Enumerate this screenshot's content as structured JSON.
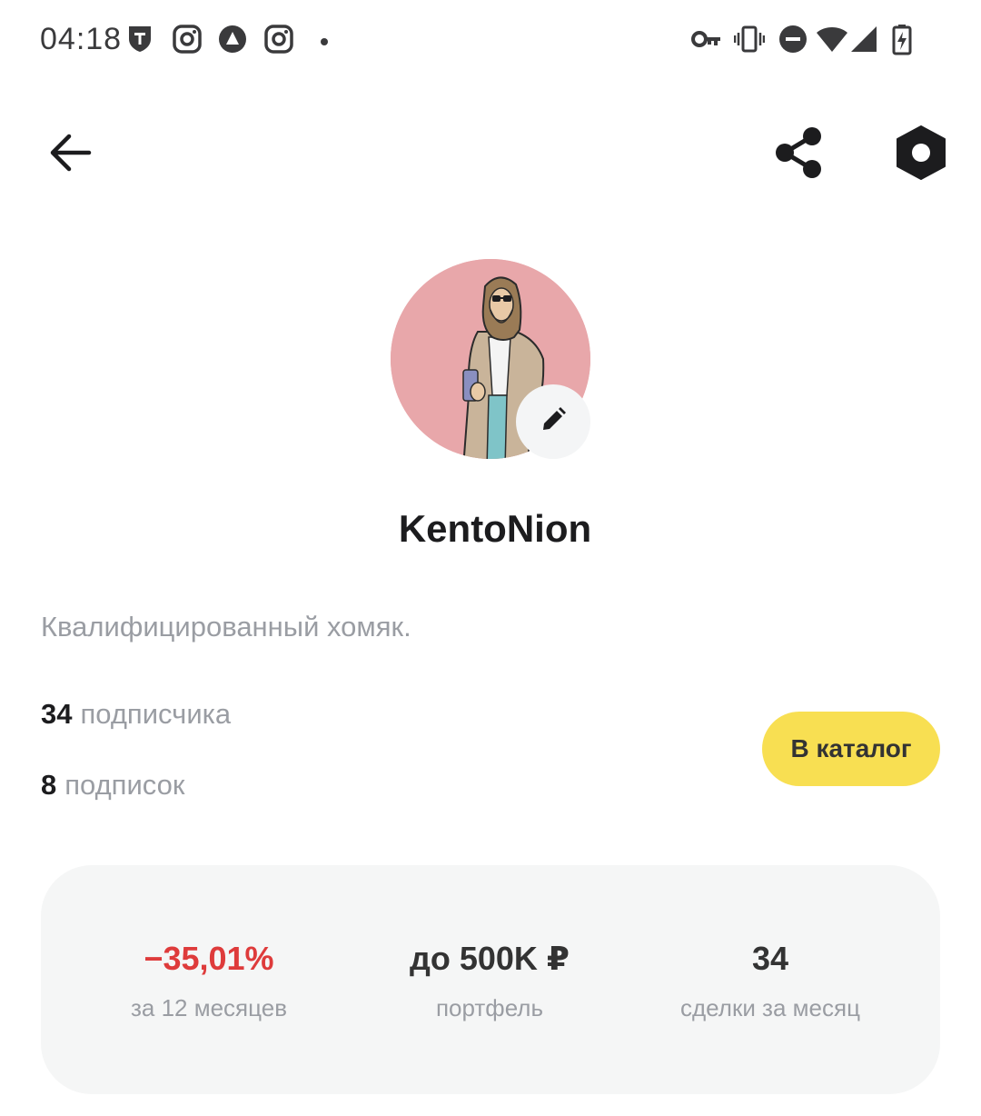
{
  "status_bar": {
    "time": "04:18",
    "left_icons": [
      "tinkoff-icon",
      "instagram-icon",
      "alice-icon",
      "instagram-icon",
      "dot-icon"
    ],
    "right_icons": [
      "vpn-key-icon",
      "vibrate-icon",
      "dnd-icon",
      "wifi-icon",
      "signal-icon",
      "battery-charging-icon"
    ]
  },
  "topbar": {
    "back_icon": "arrow-left-icon",
    "share_icon": "share-icon",
    "settings_icon": "hexagon-settings-icon"
  },
  "profile": {
    "username": "KentoNion",
    "bio": "Квалифицированный хомяк.",
    "followers_count": "34",
    "followers_label": "подписчика",
    "following_count": "8",
    "following_label": "подписок",
    "catalog_button": "В каталог"
  },
  "stats": [
    {
      "value": "−35,01%",
      "label": "за 12 месяцев",
      "negative": true
    },
    {
      "value": "до 500K ₽",
      "label": "портфель",
      "negative": false
    },
    {
      "value": "34",
      "label": "сделки за месяц",
      "negative": false
    }
  ],
  "colors": {
    "accent_yellow": "#f8df52",
    "negative_red": "#de3b3b",
    "avatar_bg": "#e8a7aa",
    "card_bg": "#f5f6f6",
    "muted_text": "#9a9da3"
  }
}
